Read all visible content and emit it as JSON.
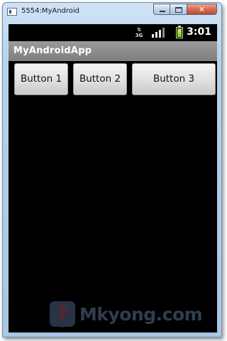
{
  "window": {
    "title": "5554:MyAndroid",
    "close_glyph": "✕"
  },
  "statusbar": {
    "network_label": "3G",
    "network_arrows": "⇅",
    "signal_bars_on": 3,
    "signal_bars_total": 4,
    "battery_icon": "battery-charging-icon",
    "clock": "3:01"
  },
  "app": {
    "title": "MyAndroidApp"
  },
  "buttons": [
    {
      "label": "Button 1"
    },
    {
      "label": "Button 2"
    },
    {
      "label": "Button 3"
    }
  ],
  "watermark": {
    "logo_mark": "?",
    "text": "Mkyong.com"
  },
  "colors": {
    "screen_bg": "#000000",
    "app_titlebar": "#8c8c8c",
    "battery_charge": "#8fd400"
  }
}
